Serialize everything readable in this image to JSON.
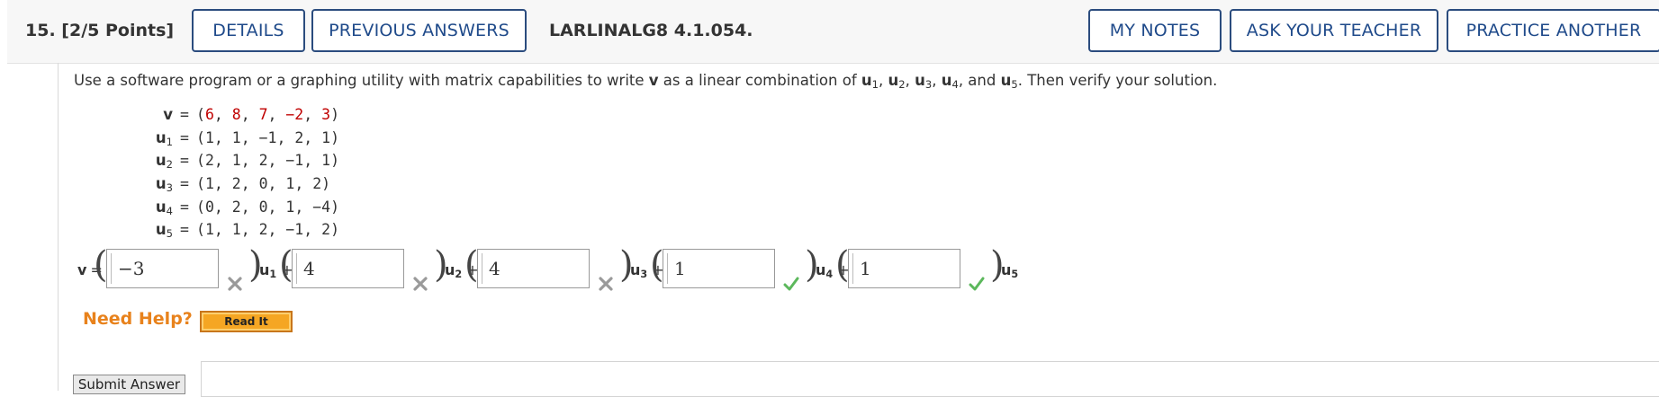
{
  "header": {
    "question_number": "15.",
    "points": "[2/5 Points]",
    "details_label": "DETAILS",
    "previous_answers_label": "PREVIOUS ANSWERS",
    "problem_code": "LARLINALG8 4.1.054.",
    "my_notes_label": "MY NOTES",
    "ask_teacher_label": "ASK YOUR TEACHER",
    "practice_label": "PRACTICE ANOTHER"
  },
  "prompt": {
    "part1": "Use a software program or a graphing utility with matrix capabilities to write ",
    "v": "v",
    "part2": " as a linear combination of ",
    "u1": "u",
    "u1_sub": "1",
    "sep1": ", ",
    "u2": "u",
    "u2_sub": "2",
    "sep2": ", ",
    "u3": "u",
    "u3_sub": "3",
    "sep3": ", ",
    "u4": "u",
    "u4_sub": "4",
    "sep4": ", and ",
    "u5": "u",
    "u5_sub": "5",
    "part3": ". Then verify your solution."
  },
  "vectors": [
    {
      "name": "v",
      "sub": "",
      "open": "(",
      "values": [
        "6",
        "8",
        "7",
        "−2",
        "3"
      ],
      "highlight": true
    },
    {
      "name": "u",
      "sub": "1",
      "open": "(",
      "values": [
        "1",
        "1",
        "−1",
        "2",
        "1"
      ],
      "highlight": false
    },
    {
      "name": "u",
      "sub": "2",
      "open": "(",
      "values": [
        "2",
        "1",
        "2",
        "−1",
        "1"
      ],
      "highlight": false
    },
    {
      "name": "u",
      "sub": "3",
      "open": "(",
      "values": [
        "1",
        "2",
        "0",
        "1",
        "2"
      ],
      "highlight": false
    },
    {
      "name": "u",
      "sub": "4",
      "open": "(",
      "values": [
        "0",
        "2",
        "0",
        "1",
        "−4"
      ],
      "highlight": false
    },
    {
      "name": "u",
      "sub": "5",
      "open": "(",
      "values": [
        "1",
        "1",
        "2",
        "−1",
        "2"
      ],
      "highlight": false
    }
  ],
  "vector_eq": "=",
  "vector_close": ")",
  "vector_sep": ", ",
  "answer": {
    "lhs": "v",
    "eq": "=",
    "open": "(",
    "close": ")",
    "plus": "+",
    "coefficients": [
      {
        "value": "−3",
        "label": "u",
        "sub": "1",
        "status": "incorrect"
      },
      {
        "value": "4",
        "label": "u",
        "sub": "2",
        "status": "incorrect"
      },
      {
        "value": "4",
        "label": "u",
        "sub": "3",
        "status": "incorrect"
      },
      {
        "value": "1",
        "label": "u",
        "sub": "4",
        "status": "correct"
      },
      {
        "value": "1",
        "label": "u",
        "sub": "5",
        "status": "correct"
      }
    ]
  },
  "help": {
    "need_help": "Need Help?",
    "read_it": "Read It"
  },
  "submit_label": "Submit Answer",
  "colors": {
    "accent_blue": "#1f4a8a",
    "help_orange": "#e8821c",
    "value_red": "#c00000",
    "correct_green": "#5cb85c",
    "incorrect_gray": "#9a9a9a"
  }
}
